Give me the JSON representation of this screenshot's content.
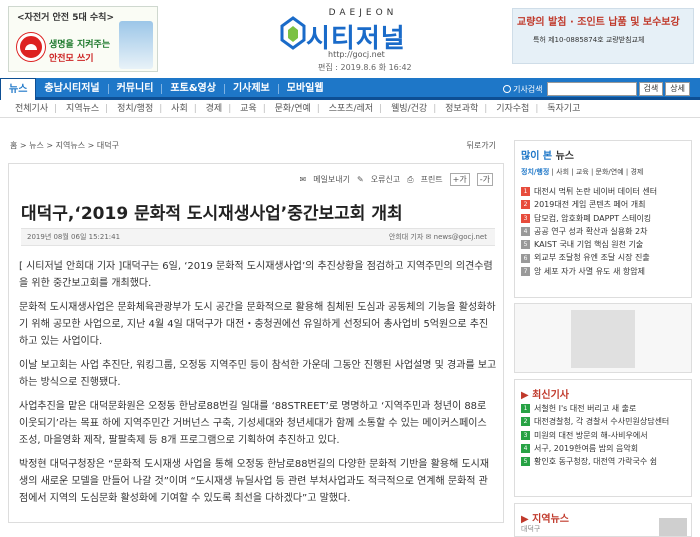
{
  "ad_left": {
    "headline": "<자전거 안전 5대 수칙>",
    "line1": "생명을 지켜주는",
    "line2": "안전모 쓰기"
  },
  "logo": {
    "en": "DAEJEON",
    "ko": "시티저널",
    "url": "http://gocj.net"
  },
  "date_edit": "편집 : 2019.8.6 화 16:42",
  "ad_right": {
    "title": "교량의 발침 · 조인트 납품 및 보수보강",
    "sub": "특허 제10-0885874호 교량받침교체"
  },
  "nav": {
    "items": [
      "뉴스",
      "충남시티저널",
      "커뮤니티",
      "포토&영상",
      "기사제보",
      "모바일웹"
    ]
  },
  "search": {
    "label": "기사검색",
    "placeholder": "",
    "btn": "검색",
    "btn_detail": "상세"
  },
  "subnav": [
    "전체기사",
    "지역뉴스",
    "정치/행정",
    "사회",
    "경제",
    "교육",
    "문화/연예",
    "스포츠/레저",
    "웰빙/건강",
    "정보과학",
    "기자수첩",
    "독자기고"
  ],
  "breadcrumb": {
    "path": "홈 > 뉴스 > 지역뉴스 > 대덕구",
    "print_link": "뒤로가기"
  },
  "tools": [
    "메일보내기",
    "오류신고",
    "프린트",
    "+가",
    "-가"
  ],
  "article": {
    "title": "대덕구,‘2019 문화적 도시재생사업’중간보고회 개최",
    "date": "2019년 08월 06일  15:21:41",
    "reporter": "안희대 기자",
    "email": "news@gocj.net",
    "p1": "[ 시티저널 안희대 기자 ]대덕구는 6일, ‘2019 문화적 도시재생사업’의 추진상황을 점검하고 지역주민의 의견수렴을 위한 중간보고회를 개최했다.",
    "p2": "문화적 도시재생사업은 문화체육관광부가 도시 공간을 문화적으로 활용해 침체된 도심과 공동체의 기능을 활성화하기 위해 공모한 사업으로, 지난 4월 4일 대덕구가 대전・충청권에선 유일하게 선정되어 총사업비 5억원으로 추진하고 있는 사업이다.",
    "p3": "이날 보고회는 사업 추진단, 워킹그룹, 오정동 지역주민 등이 참석한 가운데 그동안 진행된 사업설명 및 경과를 보고하는 방식으로 진행됐다.",
    "p4": "사업추진을 맡은 대덕문화원은 오정동 한남로88번길 일대를 ‘88STREET’로 명명하고 ‘지역주민과 청년이 88로 이웃되기’라는 목표 하에 지역주민간 거버넌스 구축, 기성세대와 청년세대가 함께 소통할 수 있는 메이커스페이스 조성, 마을영화 제작, 팔팔축제 등 8개 프로그램으로 기획하여 추진하고 있다.",
    "p5": "박정현 대덕구청장은 “문화적 도시재생 사업을 통해 오정동 한남로88번길의 다양한 문화적 기반을 활용해 도시재생의 새로운 모델을 만들어 나갈 것”이며 “도시재생 뉴딜사업 등 관련 부처사업과도 적극적으로 연계해 문화적 관점에서 지역의 도심문화 활성화에 기여할 수 있도록 최선을 다하겠다”고 말했다."
  },
  "most_read": {
    "title_a": "많이 본",
    "title_b": " 뉴스",
    "cats": [
      "정치/행정",
      "사회",
      "교육",
      "문화/연예",
      "경제"
    ],
    "items": [
      "대전시 먹튀 논란 네이버 데이터 센터",
      "2019대전 게임 콘텐츠 페어 개최",
      "답모컴, 암호화폐 DAPPT 스테이킹",
      "공공 연구 성과 확산과 실용화 2차",
      "KAIST 국내 기업 핵심 원천 기술",
      "외교부 조달청 유엔 조달 시장 진출",
      "앙 세포 자가 사멸 유도 새 항암제"
    ],
    "colors": [
      "#e74c3c",
      "#e74c3c",
      "#e74c3c",
      "#999999",
      "#999999",
      "#999999",
      "#999999"
    ]
  },
  "latest": {
    "title": "최신기사",
    "items": [
      "서철헌 I's 대전 버리고 새 출로",
      "대전경찰청, 각 경찰서 수사민원상담센터",
      "미원의 대전 방문의 해-사비우에서",
      "서구, 2019한여름 밤의 음악회",
      "황인호 동구청장, 대전역 가락국수 쉼"
    ]
  },
  "local_news": {
    "title": "지역뉴스",
    "sub": "대덕구"
  }
}
